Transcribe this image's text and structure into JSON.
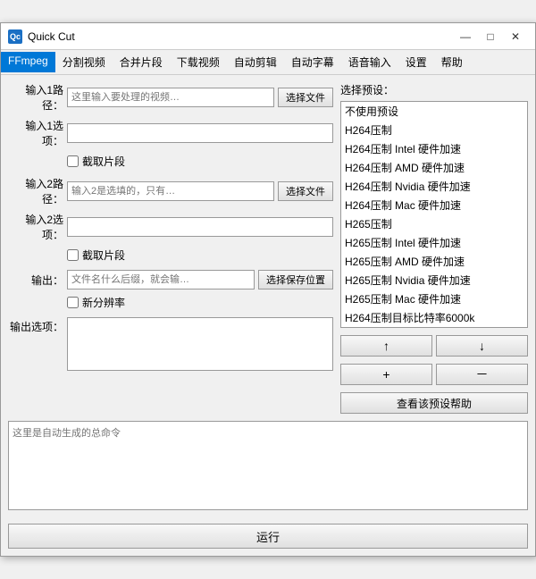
{
  "window": {
    "title": "Quick Cut",
    "icon_label": "Qc",
    "controls": {
      "minimize": "—",
      "maximize": "□",
      "close": "✕"
    }
  },
  "menu": {
    "items": [
      "FFmpeg",
      "分割视频",
      "合并片段",
      "下载视频",
      "自动剪辑",
      "自动字幕",
      "语音输入",
      "设置",
      "帮助"
    ],
    "active_index": 0
  },
  "left": {
    "input1_label": "输入1路径：",
    "input1_placeholder": "这里输入要处理的视频…",
    "input1_btn": "选择文件",
    "input1_options_label": "输入1选项：",
    "input1_options_value": "",
    "clip1_label": "截取片段",
    "input2_label": "输入2路径：",
    "input2_placeholder": "输入2是选填的，只有…",
    "input2_btn": "选择文件",
    "input2_options_label": "输入2选项：",
    "input2_options_value": "",
    "clip2_label": "截取片段",
    "output_label": "输出：",
    "output_placeholder": "文件名什么后缀，就会输…",
    "output_btn": "选择保存位置",
    "new_resolution_label": "新分辨率",
    "output_options_label": "输出选项：",
    "output_options_value": ""
  },
  "right": {
    "section_label": "选择预设：",
    "presets": [
      "不使用预设",
      "H264压制",
      "H264压制 Intel 硬件加速",
      "H264压制 AMD 硬件加速",
      "H264压制 Nvidia 硬件加速",
      "H264压制 Mac 硬件加速",
      "H265压制",
      "H265压制 Intel 硬件加速",
      "H265压制 AMD 硬件加速",
      "H265压制 Nvidia 硬件加速",
      "H265压制 Mac 硬件加速",
      "H264压制目标比特率6000k"
    ],
    "btn_up": "↑",
    "btn_down": "↓",
    "btn_add": "+",
    "btn_remove": "－",
    "help_btn": "查看该预设帮助"
  },
  "command": {
    "placeholder": "这里是自动生成的总命令"
  },
  "run": {
    "label": "运行"
  }
}
